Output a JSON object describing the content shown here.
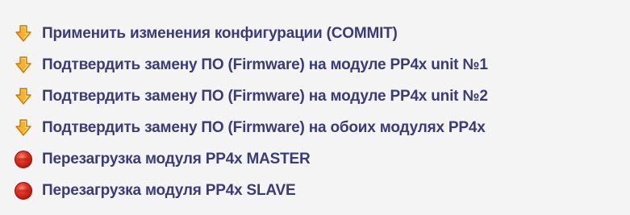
{
  "menu": {
    "items": [
      {
        "label": "Применить изменения конфигурации (COMMIT)",
        "icon": "down-arrow-icon"
      },
      {
        "label": "Подтвердить замену ПО (Firmware) на модуле PP4x unit №1",
        "icon": "down-arrow-icon"
      },
      {
        "label": "Подтвердить замену ПО (Firmware) на модуле PP4x unit №2",
        "icon": "down-arrow-icon"
      },
      {
        "label": "Подтвердить замену ПО (Firmware) на обоих модулях PP4x",
        "icon": "down-arrow-icon"
      },
      {
        "label": "Перезагрузка модуля PP4x MASTER",
        "icon": "red-stop-icon"
      },
      {
        "label": "Перезагрузка модуля PP4x SLAVE",
        "icon": "red-stop-icon"
      }
    ]
  },
  "colors": {
    "text": "#3b3b78",
    "background": "#f4f4f4",
    "arrow_fill": "#f6b22a",
    "arrow_stroke": "#c77a12",
    "stop_fill": "#d92a1c",
    "stop_stroke": "#8f1208"
  }
}
